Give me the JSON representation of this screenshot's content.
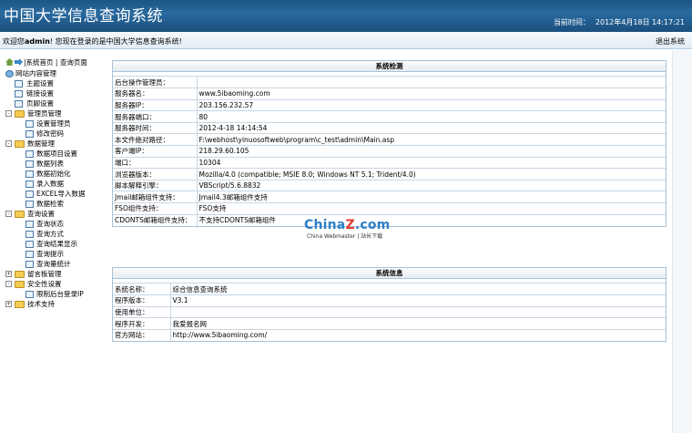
{
  "header": {
    "title": "中国大学信息查询系统",
    "time_label": "当前时间：",
    "time_value": "2012年4月18日 14:17:21"
  },
  "welcome": {
    "prefix": "欢迎您",
    "user": "admin",
    "suffix": "! 您现在登录的是中国大学信息查询系统!",
    "logout": "退出系统"
  },
  "sidebar": {
    "home_link": "系统首页",
    "query_link": "查询页面",
    "root": "网站内容管理",
    "groups": [
      {
        "label": "主题设置"
      },
      {
        "label": "链接设置"
      },
      {
        "label": "页脚设置"
      },
      {
        "label": "管理员管理",
        "children": [
          "设置管理员",
          "修改密码"
        ]
      },
      {
        "label": "数据管理",
        "children": [
          "数据项目设置",
          "数据列表",
          "数据初始化",
          "录入数据",
          "EXCEL导入数据",
          "数据检索"
        ]
      },
      {
        "label": "查询设置",
        "children": [
          "查询状态",
          "查询方式",
          "查询结果显示",
          "查询提示",
          "查询量统计"
        ]
      },
      {
        "label": "留言板管理"
      },
      {
        "label": "安全性设置",
        "children": [
          "限制后台登录IP"
        ]
      },
      {
        "label": "技术支持"
      }
    ]
  },
  "system_check": {
    "title": "系统检测",
    "rows": [
      {
        "label": "后台操作管理员：",
        "value": ""
      },
      {
        "label": "服务器名：",
        "value": "www.5ibaoming.com"
      },
      {
        "label": "服务器IP：",
        "value": "203.156.232.57"
      },
      {
        "label": "服务器端口：",
        "value": "80"
      },
      {
        "label": "服务器时间：",
        "value": "2012-4-18 14:14:54"
      },
      {
        "label": "本文件绝对路径：",
        "value": "F:\\webhost\\yinuosoftweb\\program\\c_test\\admin\\Main.asp"
      },
      {
        "label": "客户端IP：",
        "value": "218.29.60.105"
      },
      {
        "label": "端口：",
        "value": "10304"
      },
      {
        "label": "浏览器版本：",
        "value": "Mozilla/4.0 (compatible; MSIE 8.0; Windows NT 5.1; Trident/4.0)"
      },
      {
        "label": "脚本解释引擎：",
        "value": "VBScript/5.6.8832"
      },
      {
        "label": "Jmail邮箱组件支持：",
        "value": "Jmail4.3邮箱组件支持"
      },
      {
        "label": "FSO组件支持：",
        "value": "FSO支持"
      },
      {
        "label": "CDONTS邮箱组件支持：",
        "value": "不支持CDONTS邮箱组件"
      }
    ]
  },
  "system_info": {
    "title": "系统信息",
    "rows": [
      {
        "label": "系统名称：",
        "value": "综合信息查询系统"
      },
      {
        "label": "程序版本：",
        "value": "V3.1"
      },
      {
        "label": "使用单位：",
        "value": ""
      },
      {
        "label": "程序开发：",
        "value": "我爱报名网"
      },
      {
        "label": "官方网站：",
        "value": "http://www.5ibaoming.com/"
      }
    ]
  },
  "watermark": {
    "brand_a": "China",
    "brand_z": "Z",
    "brand_b": ".com",
    "sub": "China Webmaster | 站长下载"
  },
  "colors": {
    "header_bg": "#1c5482",
    "panel_border": "#a9c1d8",
    "folder": "#f5cc51"
  }
}
